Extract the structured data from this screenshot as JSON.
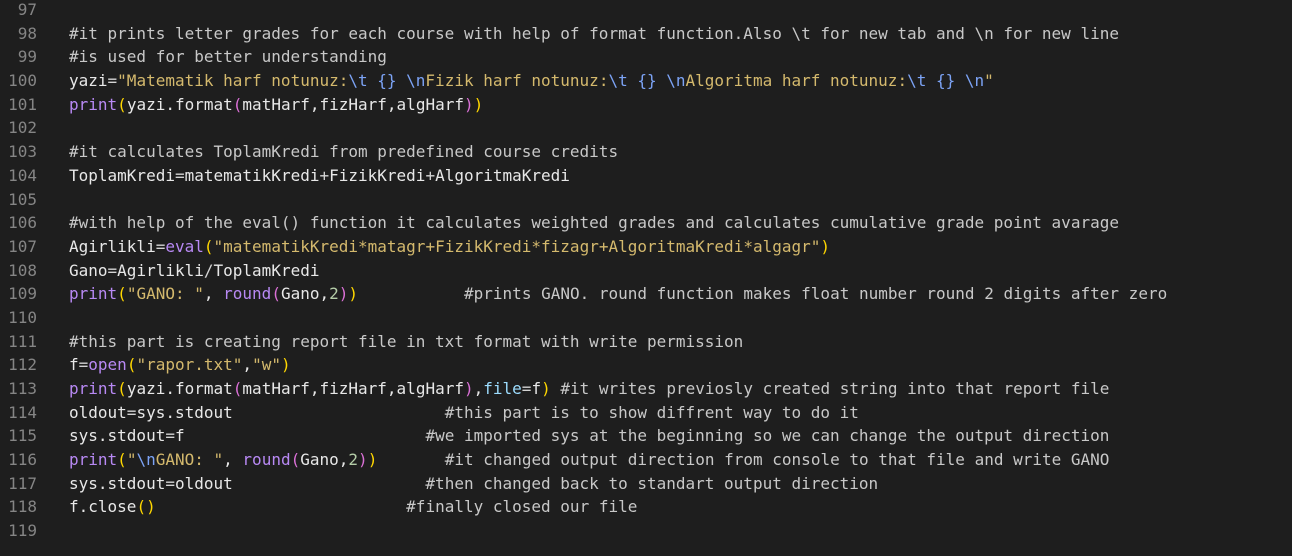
{
  "editor": {
    "lines": [
      {
        "n": "97"
      },
      {
        "n": "98",
        "t": [
          "#it prints letter grades for each course with help of format function.Also \\t for new tab and \\n for new line"
        ]
      },
      {
        "n": "99",
        "t": [
          "#is used for better understanding"
        ]
      },
      {
        "n": "100",
        "t": [
          "yazi",
          "=",
          "\"Matematik harf notunuz:",
          "\\t",
          " {} ",
          "\\n",
          "Fizik harf notunuz:",
          "\\t",
          " {} ",
          "\\n",
          "Algoritma harf notunuz:",
          "\\t",
          " {} ",
          "\\n",
          "\""
        ]
      },
      {
        "n": "101",
        "t": [
          "print",
          "(",
          "yazi.format",
          "(",
          "matHarf,fizHarf,algHarf",
          ")",
          ")"
        ]
      },
      {
        "n": "102"
      },
      {
        "n": "103",
        "t": [
          "#it calculates ToplamKredi from predefined course credits"
        ]
      },
      {
        "n": "104",
        "t": [
          "ToplamKredi",
          "=",
          "matematikKredi",
          "+",
          "FizikKredi",
          "+",
          "AlgoritmaKredi"
        ]
      },
      {
        "n": "105"
      },
      {
        "n": "106",
        "t": [
          "#with help of the eval() function it calculates weighted grades and calculates cumulative grade point avarage"
        ]
      },
      {
        "n": "107",
        "t": [
          "Agirlikli",
          "=",
          "eval",
          "(",
          "\"matematikKredi*matagr+FizikKredi*fizagr+AlgoritmaKredi*algagr\"",
          ")"
        ]
      },
      {
        "n": "108",
        "t": [
          "Gano",
          "=",
          "Agirlikli",
          "/",
          "ToplamKredi"
        ]
      },
      {
        "n": "109",
        "t": [
          "print",
          "(",
          "\"GANO: \"",
          ", ",
          "round",
          "(",
          "Gano,",
          "2",
          ")",
          ")",
          "           ",
          "#prints GANO. round function makes float number round 2 digits after zero"
        ]
      },
      {
        "n": "110"
      },
      {
        "n": "111",
        "t": [
          "#this part is creating report file in txt format with write permission"
        ]
      },
      {
        "n": "112",
        "t": [
          "f",
          "=",
          "open",
          "(",
          "\"rapor.txt\"",
          ",",
          "\"w\"",
          ")"
        ]
      },
      {
        "n": "113",
        "t": [
          "print",
          "(",
          "yazi.format",
          "(",
          "matHarf,fizHarf,algHarf",
          ")",
          ",",
          "file",
          "=",
          "f",
          ")",
          " ",
          "#it writes previosly created string into that report file"
        ]
      },
      {
        "n": "114",
        "t": [
          "oldout",
          "=",
          "sys.stdout",
          "                      ",
          "#this part is to show diffrent way to do it"
        ]
      },
      {
        "n": "115",
        "t": [
          "sys.stdout",
          "=",
          "f",
          "                         ",
          "#we imported sys at the beginning so we can change the output direction"
        ]
      },
      {
        "n": "116",
        "t": [
          "print",
          "(",
          "\"",
          "\\n",
          "GANO: \"",
          ", ",
          "round",
          "(",
          "Gano,",
          "2",
          ")",
          ")",
          "       ",
          "#it changed output direction from console to that file and write GANO"
        ]
      },
      {
        "n": "117",
        "t": [
          "sys.stdout",
          "=",
          "oldout",
          "                    ",
          "#then changed back to standart output direction"
        ]
      },
      {
        "n": "118",
        "t": [
          "f.close",
          "(",
          ")",
          "                          ",
          "#finally closed our file"
        ]
      },
      {
        "n": "119"
      }
    ]
  },
  "classes": {
    "100": [
      "var",
      "op",
      "str",
      "esc",
      "esc",
      "esc",
      "str",
      "esc",
      "esc",
      "esc",
      "str",
      "esc",
      "esc",
      "esc",
      "str"
    ],
    "101": [
      "bi",
      "p1",
      "var",
      "p2",
      "var",
      "p2",
      "p1"
    ],
    "104": [
      "var",
      "op",
      "var",
      "op",
      "var",
      "op",
      "var"
    ],
    "107": [
      "var",
      "op",
      "bi",
      "p1",
      "str",
      "p1"
    ],
    "108": [
      "var",
      "op",
      "var",
      "op",
      "var"
    ],
    "109": [
      "bi",
      "p1",
      "str",
      "var",
      "bi",
      "p2",
      "var",
      "num",
      "p2",
      "p1",
      "var",
      "cm"
    ],
    "112": [
      "var",
      "op",
      "bi",
      "p1",
      "str",
      "var",
      "str",
      "p1"
    ],
    "113": [
      "bi",
      "p1",
      "var",
      "p2",
      "var",
      "p2",
      "var",
      "kw",
      "op",
      "var",
      "p1",
      "var",
      "cm"
    ],
    "114": [
      "var",
      "op",
      "var",
      "var",
      "cm"
    ],
    "115": [
      "var",
      "op",
      "var",
      "var",
      "cm"
    ],
    "116": [
      "bi",
      "p1",
      "str",
      "esc",
      "str",
      "var",
      "bi",
      "p2",
      "var",
      "num",
      "p2",
      "p1",
      "var",
      "cm"
    ],
    "117": [
      "var",
      "op",
      "var",
      "var",
      "cm"
    ],
    "118": [
      "var",
      "p1",
      "p1",
      "var",
      "cm"
    ]
  }
}
